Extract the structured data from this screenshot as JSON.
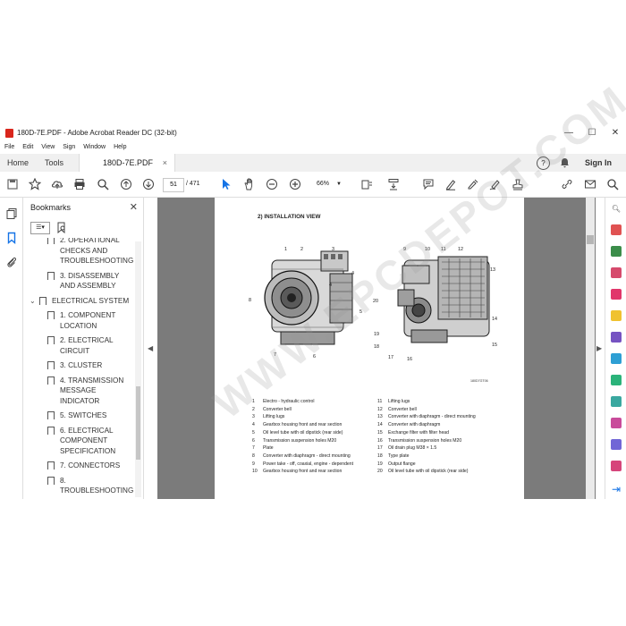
{
  "window": {
    "title": "180D-7E.PDF - Adobe Acrobat Reader DC (32-bit)",
    "controls": {
      "minimize": "—",
      "maximize": "☐",
      "close": "✕"
    }
  },
  "menu": [
    "File",
    "Edit",
    "View",
    "Sign",
    "Window",
    "Help"
  ],
  "tabs": {
    "home": "Home",
    "tools": "Tools",
    "file": "180D-7E.PDF",
    "close": "×",
    "signin": "Sign In"
  },
  "toolbar": {
    "page_current": "51",
    "page_total": "/  471",
    "zoom": "66%"
  },
  "bookmarks": {
    "title": "Bookmarks",
    "items": [
      {
        "label": "2. OPERATIONAL",
        "indent": 2
      },
      {
        "label": "CHECKS AND",
        "indent": 2,
        "cont": true
      },
      {
        "label": "TROUBLESHOOTING",
        "indent": 2,
        "cont": true
      },
      {
        "label": "3. DISASSEMBLY",
        "indent": 2
      },
      {
        "label": "AND ASSEMBLY",
        "indent": 2,
        "cont": true
      },
      {
        "label": "ELECTRICAL SYSTEM",
        "indent": 1
      },
      {
        "label": "1. COMPONENT",
        "indent": 2
      },
      {
        "label": "LOCATION",
        "indent": 2,
        "cont": true
      },
      {
        "label": "2. ELECTRICAL",
        "indent": 2
      },
      {
        "label": "CIRCUIT",
        "indent": 2,
        "cont": true
      },
      {
        "label": "3. CLUSTER",
        "indent": 2
      },
      {
        "label": "4. TRANSMISSION",
        "indent": 2
      },
      {
        "label": "MESSAGE",
        "indent": 2,
        "cont": true
      },
      {
        "label": "INDICATOR",
        "indent": 2,
        "cont": true
      },
      {
        "label": "5. SWITCHES",
        "indent": 2
      },
      {
        "label": "6. ELECTRICAL",
        "indent": 2
      },
      {
        "label": "COMPONENT",
        "indent": 2,
        "cont": true
      },
      {
        "label": "SPECIFICATION",
        "indent": 2,
        "cont": true
      },
      {
        "label": "7. CONNECTORS",
        "indent": 2
      },
      {
        "label": "8.",
        "indent": 2
      },
      {
        "label": "TROUBLESHOOTING",
        "indent": 2,
        "cont": true
      }
    ]
  },
  "document": {
    "heading": "2) INSTALLATION VIEW",
    "figure_code": "180D7GT06",
    "callouts_left": [
      "1",
      "2",
      "3",
      "4",
      "4",
      "5",
      "6",
      "7",
      "8"
    ],
    "callouts_right": [
      "9",
      "10",
      "11",
      "12",
      "13",
      "14",
      "15",
      "16",
      "17",
      "18",
      "19",
      "20"
    ],
    "legend_left": [
      {
        "n": "1",
        "t": "Electro - hydraulic control"
      },
      {
        "n": "2",
        "t": "Converter bell"
      },
      {
        "n": "3",
        "t": "Lifting lugs"
      },
      {
        "n": "4",
        "t": "Gearbox housing front and rear section"
      },
      {
        "n": "5",
        "t": "Oil level tube with oil dipstick (rear side)"
      },
      {
        "n": "6",
        "t": "Transmission suspension holes M20"
      },
      {
        "n": "7",
        "t": "Plate"
      },
      {
        "n": "8",
        "t": "Converter with diaphragm - direct mounting"
      },
      {
        "n": "9",
        "t": "Power take - off, coaxial, engine - dependent"
      },
      {
        "n": "10",
        "t": "Gearbox housing front and rear section"
      }
    ],
    "legend_right": [
      {
        "n": "11",
        "t": "Lifting lugs"
      },
      {
        "n": "12",
        "t": "Converter bell"
      },
      {
        "n": "13",
        "t": "Converter with diaphragm - direct mounting"
      },
      {
        "n": "14",
        "t": "Converter with diaphragm"
      },
      {
        "n": "15",
        "t": "Exchange filter with filter head"
      },
      {
        "n": "16",
        "t": "Transmission suspension holes M20"
      },
      {
        "n": "17",
        "t": "Oil drain plug M38 × 1.5"
      },
      {
        "n": "18",
        "t": "Type plate"
      },
      {
        "n": "19",
        "t": "Output flange"
      },
      {
        "n": "20",
        "t": "Oil level tube with oil dipstick (rear side)"
      }
    ]
  },
  "watermark": "WWW.EPCDEPOT.COM",
  "colors": {
    "accent": "#1473e6",
    "doc_bg": "#7b7b7b",
    "acrobat_red": "#d9261c"
  }
}
